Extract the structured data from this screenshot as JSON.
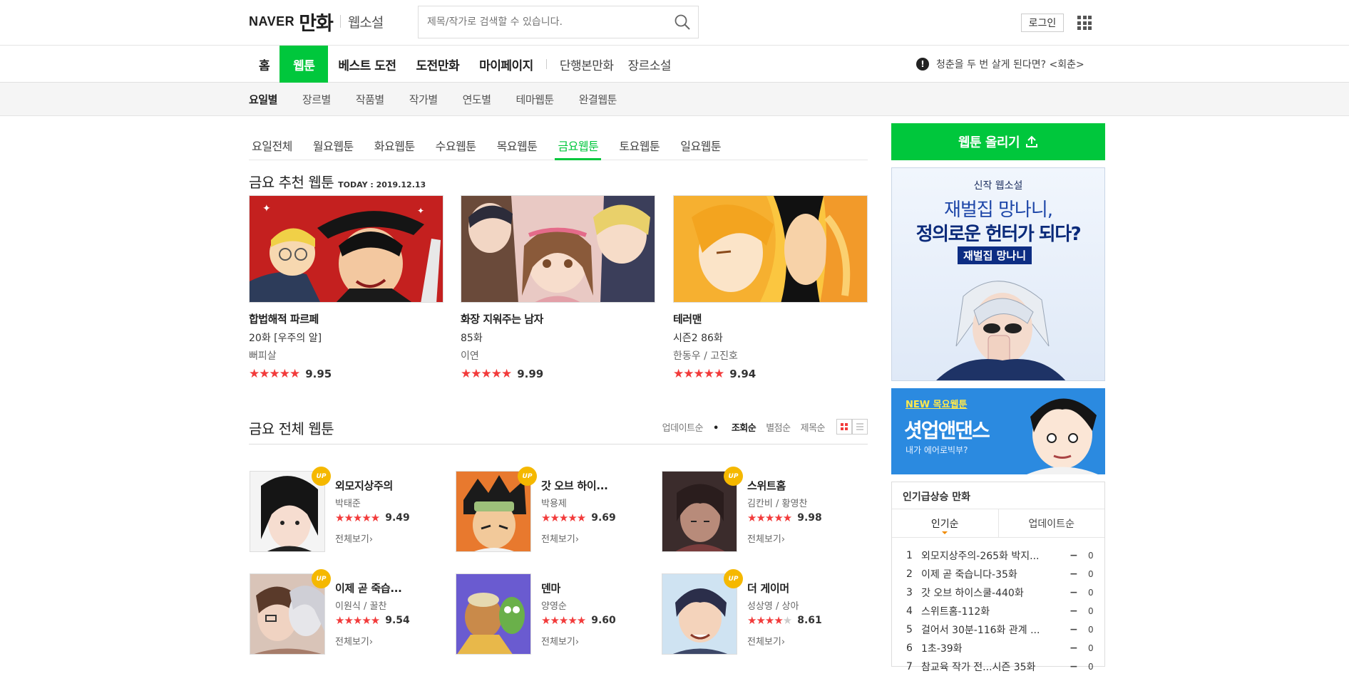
{
  "header": {
    "logo_naver": "NAVER",
    "logo_manhwa": "만화",
    "logo_novel": "웹소설",
    "search_placeholder": "제목/작가로 검색할 수 있습니다.",
    "login_label": "로그인"
  },
  "gnb": {
    "items": [
      "홈",
      "웹툰",
      "베스트 도전",
      "도전만화",
      "마이페이지",
      "단행본만화",
      "장르소설"
    ],
    "notice": "청춘을 두 번 살게 된다면? <회춘>"
  },
  "lnb": {
    "items": [
      "요일별",
      "장르별",
      "작품별",
      "작가별",
      "연도별",
      "테마웹툰",
      "완결웹툰"
    ]
  },
  "day_tabs": [
    "요일전체",
    "월요웹툰",
    "화요웹툰",
    "수요웹툰",
    "목요웹툰",
    "금요웹툰",
    "토요웹툰",
    "일요웹툰"
  ],
  "recommend": {
    "title": "금요 추천 웹툰",
    "today": "TODAY : 2019.12.13",
    "cards": [
      {
        "title": "합법해적 파르페",
        "episode": "20화 [우주의 알]",
        "author": "뻐피살",
        "rating": "9.95"
      },
      {
        "title": "화장 지워주는 남자",
        "episode": "85화",
        "author": "이연",
        "rating": "9.99"
      },
      {
        "title": "테러맨",
        "episode": "시즌2 86화",
        "author": "한동우 / 고진호",
        "rating": "9.94"
      }
    ]
  },
  "all": {
    "title": "금요 전체 웹툰",
    "sort": [
      "업데이트순",
      "조회순",
      "별점순",
      "제목순"
    ],
    "more_label": "전체보기",
    "up_label": "UP",
    "items": [
      {
        "title": "외모지상주의",
        "author": "박태준",
        "rating": "9.49",
        "up": true
      },
      {
        "title": "갓 오브 하이...",
        "author": "박용제",
        "rating": "9.69",
        "up": true
      },
      {
        "title": "스위트홈",
        "author": "김칸비 / 황영찬",
        "rating": "9.98",
        "up": true
      },
      {
        "title": "이제 곧 죽습...",
        "author": "이원식 / 꿀찬",
        "rating": "9.54",
        "up": true
      },
      {
        "title": "덴마",
        "author": "양영순",
        "rating": "9.60",
        "up": false
      },
      {
        "title": "더 게이머",
        "author": "성상영 / 상아",
        "rating": "8.61",
        "up": true
      }
    ]
  },
  "sidebar": {
    "upload_label": "웹툰 올리기",
    "banner1": {
      "sub": "신작 웹소설",
      "line1": "재벌집 망나니,",
      "line2": "정의로운 헌터가 되다?",
      "tag": "재벌집 망나니"
    },
    "banner2": {
      "new": "NEW 목요웹툰",
      "title": "셧업앤댄스",
      "sub": "내가 에어로빅부?"
    },
    "rank": {
      "title": "인기급상승 만화",
      "tabs": [
        "인기순",
        "업데이트순"
      ],
      "rows": [
        {
          "num": "1",
          "name": "외모지상주의-265화 박지...",
          "dash": "−",
          "val": "0"
        },
        {
          "num": "2",
          "name": "이제 곧 죽습니다-35화",
          "dash": "−",
          "val": "0"
        },
        {
          "num": "3",
          "name": "갓 오브 하이스쿨-440화",
          "dash": "−",
          "val": "0"
        },
        {
          "num": "4",
          "name": "스위트홈-112화",
          "dash": "−",
          "val": "0"
        },
        {
          "num": "5",
          "name": "걸어서 30분-116화 관계 ...",
          "dash": "−",
          "val": "0"
        },
        {
          "num": "6",
          "name": "1초-39화",
          "dash": "−",
          "val": "0"
        },
        {
          "num": "7",
          "name": "참교육 작가 전...시즌 35화",
          "dash": "−",
          "val": "0"
        }
      ]
    }
  },
  "colors": {
    "accent": "#00c73c",
    "star": "#f23b3b",
    "up_badge": "#f5b800"
  }
}
